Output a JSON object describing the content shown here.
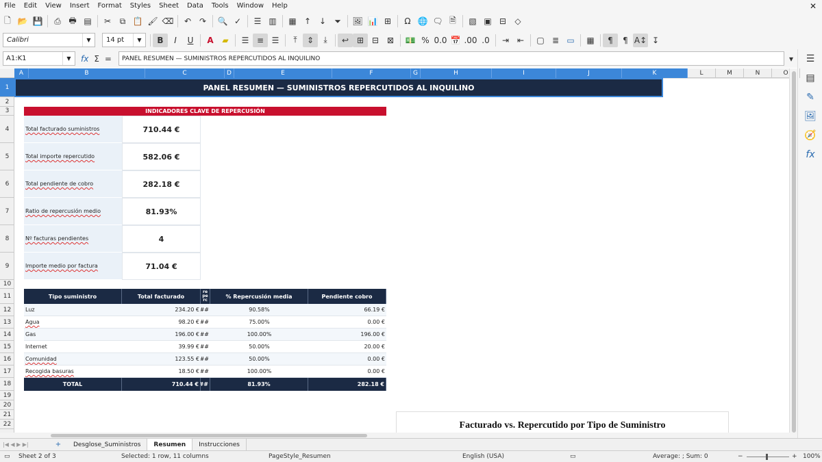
{
  "menu": [
    "File",
    "Edit",
    "View",
    "Insert",
    "Format",
    "Styles",
    "Sheet",
    "Data",
    "Tools",
    "Window",
    "Help"
  ],
  "font": {
    "name": "Calibri",
    "size": "14 pt"
  },
  "namebox": "A1:K1",
  "formula": "PANEL RESUMEN — SUMINISTROS REPERCUTIDOS AL INQUILINO",
  "columns": [
    "A",
    "B",
    "C",
    "D",
    "E",
    "F",
    "G",
    "H",
    "I",
    "J",
    "K",
    "L",
    "M",
    "N",
    "O"
  ],
  "rows": [
    "1",
    "2",
    "3",
    "4",
    "5",
    "6",
    "7",
    "8",
    "9",
    "10",
    "11",
    "12",
    "13",
    "14",
    "15",
    "16",
    "17",
    "18",
    "19",
    "20",
    "21",
    "22"
  ],
  "sheet": {
    "title": "PANEL RESUMEN — SUMINISTROS REPERCUTIDOS AL INQUILINO",
    "kpi_header": "INDICADORES CLAVE DE REPERCUSIÓN",
    "kpis": [
      {
        "label": "Total facturado suministros",
        "value": "710.44 €"
      },
      {
        "label": "Total importe repercutido",
        "value": "582.06 €"
      },
      {
        "label": "Total pendiente de cobro",
        "value": "282.18 €"
      },
      {
        "label": "Ratio de repercusión medio",
        "value": "81.93%"
      },
      {
        "label": "Nº facturas pendientes",
        "value": "4"
      },
      {
        "label": "Importe medio por factura",
        "value": "71.04 €"
      }
    ],
    "table": {
      "headers": [
        "Tipo suministro",
        "Total facturado",
        "re pe rc",
        "% Repercusión media",
        "Pendiente cobro"
      ],
      "rows": [
        [
          "Luz",
          "234.20 €",
          "###",
          "90.58%",
          "66.19 €"
        ],
        [
          "Agua",
          "98.20 €",
          "###",
          "75.00%",
          "0.00 €"
        ],
        [
          "Gas",
          "196.00 €",
          "###",
          "100.00%",
          "196.00 €"
        ],
        [
          "Internet",
          "39.99 €",
          "###",
          "50.00%",
          "20.00 €"
        ],
        [
          "Comunidad",
          "123.55 €",
          "###",
          "50.00%",
          "0.00 €"
        ],
        [
          "Recogida basuras",
          "18.50 €",
          "###",
          "100.00%",
          "0.00 €"
        ]
      ],
      "total": [
        "TOTAL",
        "710.44 €",
        "###",
        "81.93%",
        "282.18 €"
      ]
    },
    "chart_title": "Facturado vs. Repercutido por Tipo de Suministro"
  },
  "tabs": [
    "Desglose_Suministros",
    "Resumen",
    "Instrucciones"
  ],
  "status": {
    "sheet": "Sheet 2 of 3",
    "selection": "Selected: 1 row, 11 columns",
    "pagestyle": "PageStyle_Resumen",
    "language": "English (USA)",
    "summary": "Average: ; Sum: 0",
    "zoom": "100%"
  }
}
